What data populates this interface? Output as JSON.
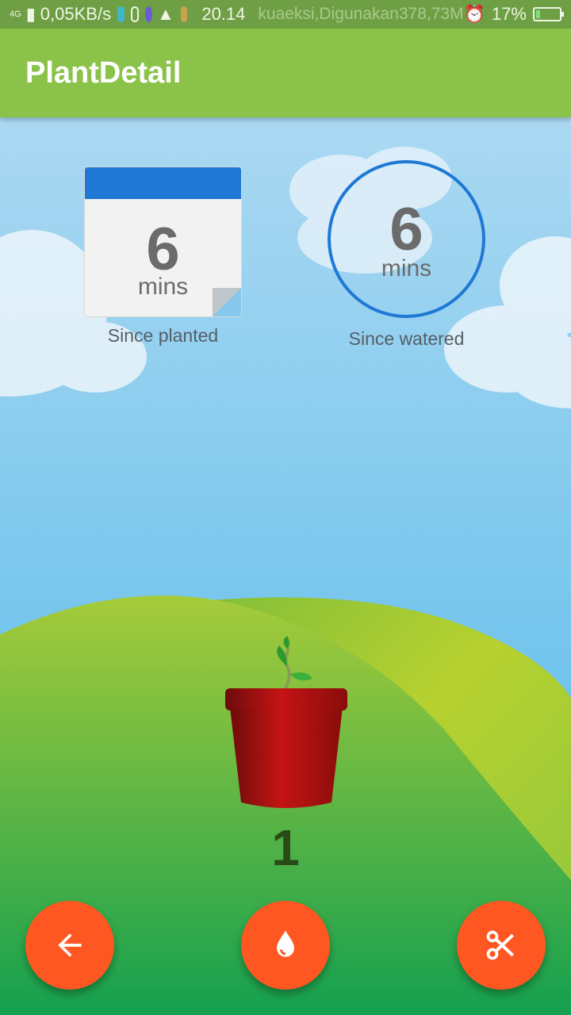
{
  "status_bar": {
    "network": "4G",
    "speed": "0,05KB/s",
    "time": "20.14",
    "background_text": "kuaeksi,Digunakan378,73M",
    "battery": "17%",
    "battery_level": 0.17
  },
  "app_bar": {
    "title": "PlantDetail"
  },
  "planted_counter": {
    "value": "6",
    "unit": "mins",
    "label": "Since planted"
  },
  "watered_counter": {
    "value": "6",
    "unit": "mins",
    "label": "Since watered"
  },
  "plant": {
    "count": "1"
  },
  "actions": [
    {
      "name": "back",
      "icon": "arrow-left-icon"
    },
    {
      "name": "water",
      "icon": "water-drop-icon"
    },
    {
      "name": "cut",
      "icon": "scissors-icon"
    }
  ],
  "colors": {
    "app_bar": "#8bc34a",
    "status_bar": "#6f9f45",
    "accent": "#ff5722",
    "counter_blue": "#1e78d4",
    "sky_top": "#b7ddf3",
    "sky_bottom": "#4fb7e9",
    "hill_light": "#b7d12f",
    "hill_dark": "#16a050",
    "pot": "#c41414"
  }
}
